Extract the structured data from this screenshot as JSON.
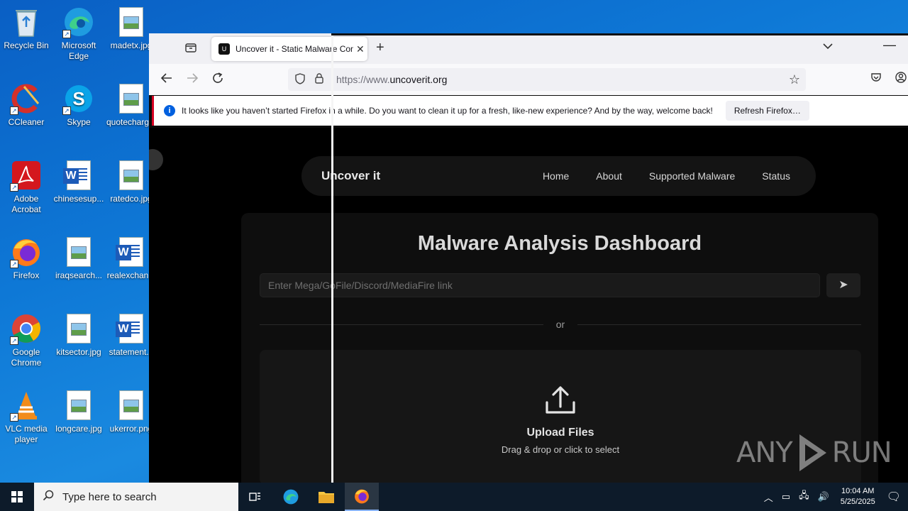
{
  "desktop": {
    "icons": [
      {
        "label": "Recycle Bin"
      },
      {
        "label": "Microsoft Edge"
      },
      {
        "label": "madetx.jpg"
      },
      {
        "label": "CCleaner"
      },
      {
        "label": "Skype"
      },
      {
        "label": "quotecharg..."
      },
      {
        "label": "Adobe Acrobat"
      },
      {
        "label": "chinesesup..."
      },
      {
        "label": "ratedco.jpg"
      },
      {
        "label": "Firefox"
      },
      {
        "label": "iraqsearch..."
      },
      {
        "label": "realexchan..."
      },
      {
        "label": "Google Chrome"
      },
      {
        "label": "kitsector.jpg"
      },
      {
        "label": "statement..."
      },
      {
        "label": "VLC media player"
      },
      {
        "label": "longcare.jpg"
      },
      {
        "label": "ukerror.png"
      }
    ]
  },
  "browser": {
    "tab": {
      "title": "Uncover it - Static Malware Con",
      "favicon": "U"
    },
    "url": {
      "protocol": "https://www.",
      "domain": "uncoverit.org"
    },
    "notification": {
      "message": "It looks like you haven’t started Firefox in a while. Do you want to clean it up for a fresh, like-new experience? And by the way, welcome back!",
      "button": "Refresh Firefox…"
    }
  },
  "site": {
    "logo": "Uncover it",
    "nav": [
      "Home",
      "About",
      "Supported Malware",
      "Status"
    ],
    "title": "Malware Analysis Dashboard",
    "input_placeholder": "Enter Mega/GoFile/Discord/MediaFire link",
    "send_icon": "➤",
    "divider_text": "or",
    "upload_title": "Upload Files",
    "upload_subtitle": "Drag & drop or click to select"
  },
  "watermark": {
    "left": "ANY",
    "right": "RUN"
  },
  "taskbar": {
    "search_placeholder": "Type here to search",
    "time": "10:04 AM",
    "date": "5/25/2025"
  },
  "colors": {
    "desktop_bg": "#0e78d6",
    "notification_accent": "#d70022",
    "info_blue": "#0060df",
    "site_bg": "#000000"
  }
}
